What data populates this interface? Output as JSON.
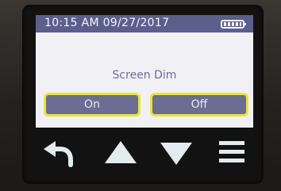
{
  "status_bar": {
    "datetime": "10:15 AM 09/27/2017",
    "battery_level": 1.0
  },
  "dialog": {
    "title": "Screen Dim",
    "on_label": "On",
    "off_label": "Off"
  },
  "controls": {
    "back_icon": "back-arrow-icon",
    "up_icon": "triangle-up-icon",
    "down_icon": "triangle-down-icon",
    "menu_icon": "menu-icon"
  },
  "colors": {
    "status_bar": "#5c5f8c",
    "button": "#6b6d93",
    "button_border": "#e9e43a",
    "screen": "#f1f0f4",
    "controls": "#e4ebef"
  }
}
